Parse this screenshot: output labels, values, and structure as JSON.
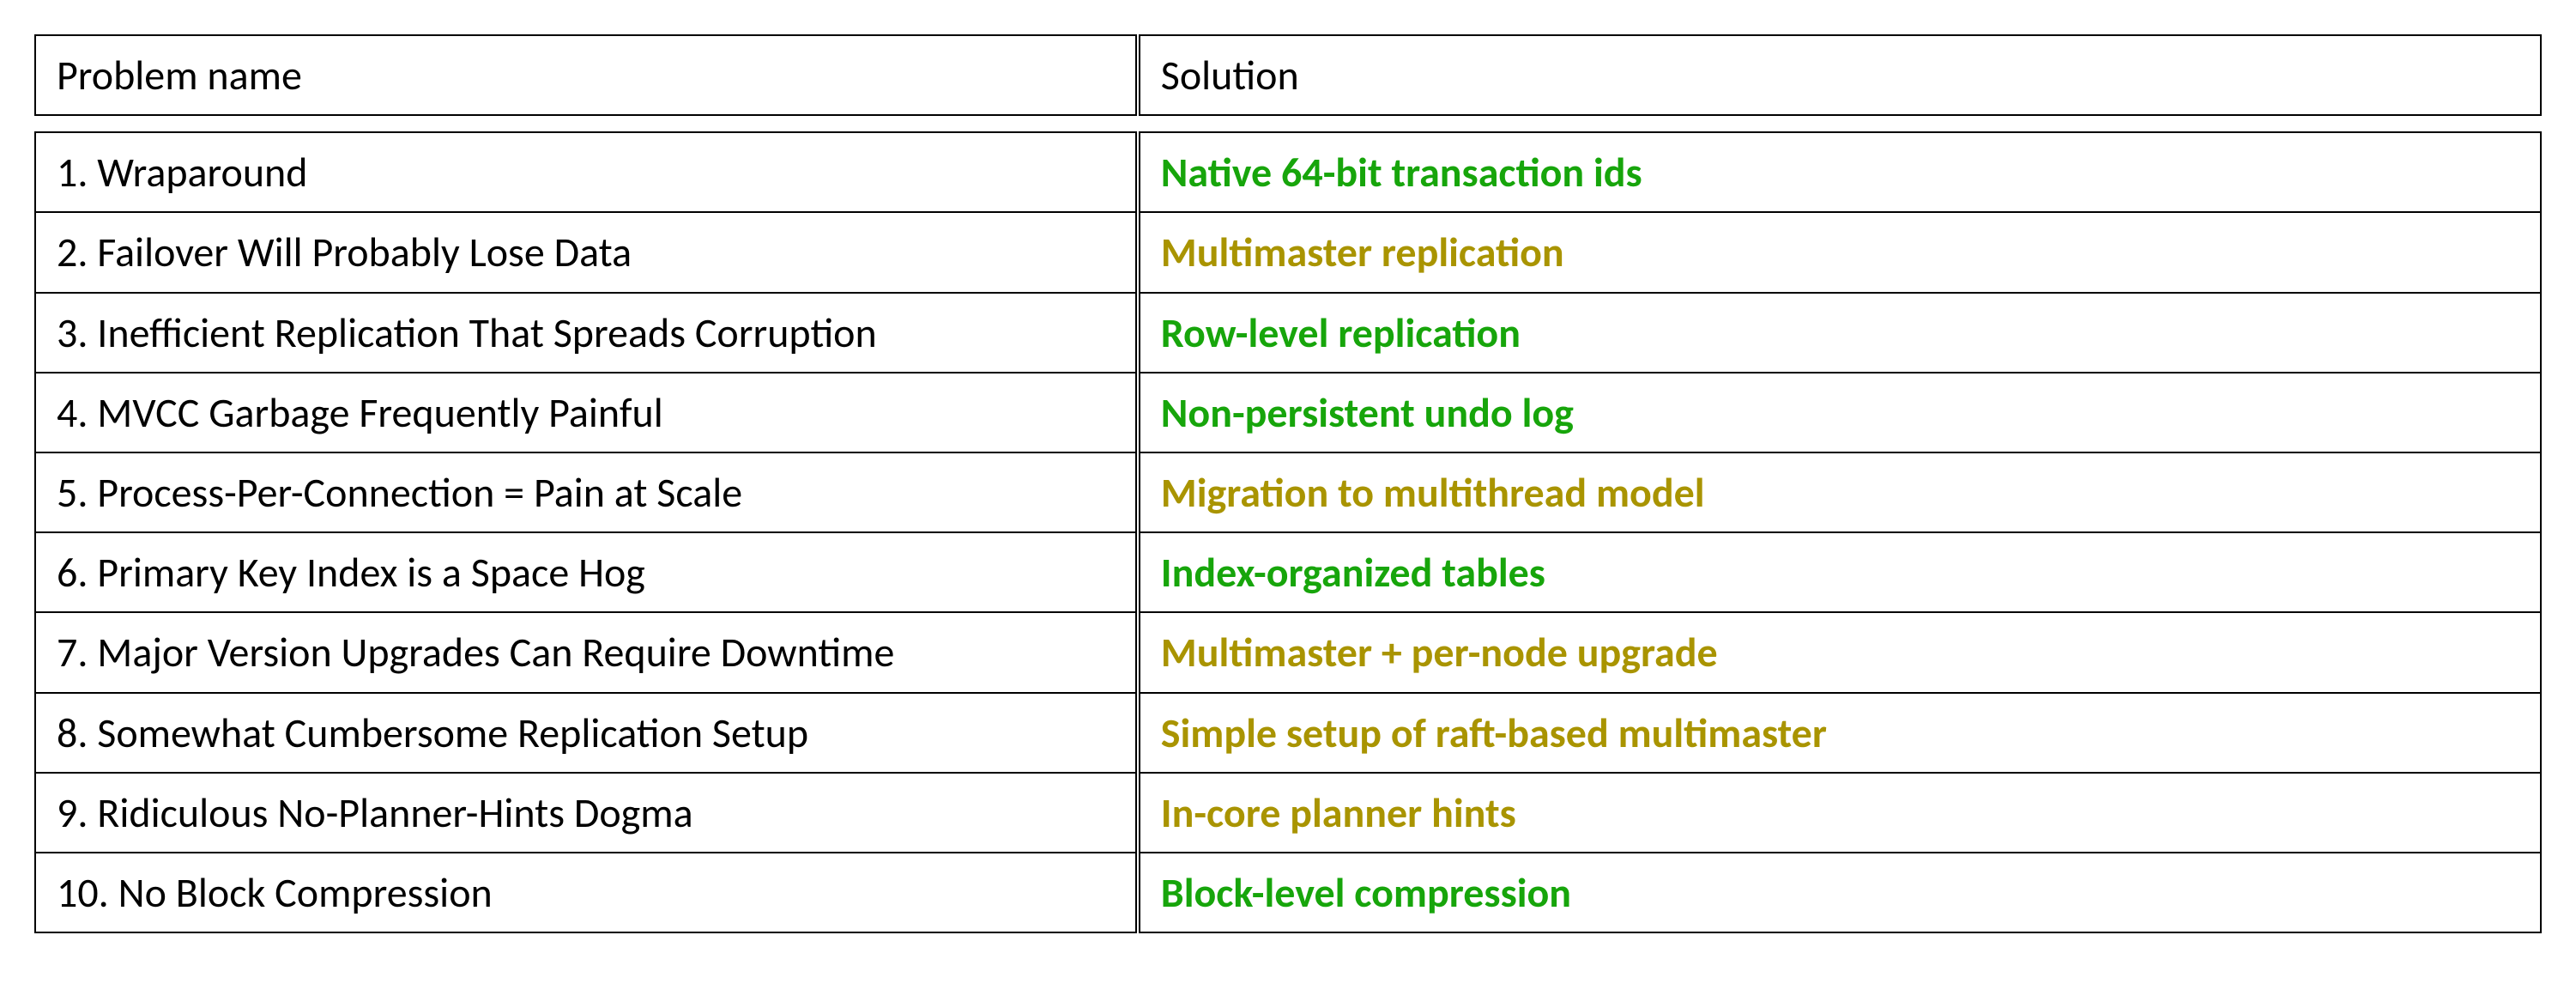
{
  "headers": {
    "problem": "Problem name",
    "solution": "Solution"
  },
  "rows": [
    {
      "problem": "1. Wraparound",
      "solution": "Native 64-bit transaction ids",
      "color": "green"
    },
    {
      "problem": "2. Failover Will Probably Lose Data",
      "solution": "Multimaster replication",
      "color": "olive"
    },
    {
      "problem": "3. Inefficient Replication That Spreads Corruption",
      "solution": "Row-level replication",
      "color": "green"
    },
    {
      "problem": "4. MVCC Garbage Frequently Painful",
      "solution": "Non-persistent undo log",
      "color": "green"
    },
    {
      "problem": "5. Process-Per-Connection = Pain at Scale",
      "solution": "Migration to multithread model",
      "color": "olive"
    },
    {
      "problem": "6. Primary Key Index is a Space Hog",
      "solution": "Index-organized tables",
      "color": "green"
    },
    {
      "problem": "7. Major Version Upgrades Can Require Downtime",
      "solution": "Multimaster + per-node upgrade",
      "color": "olive"
    },
    {
      "problem": "8. Somewhat Cumbersome Replication Setup",
      "solution": "Simple setup of raft-based multimaster",
      "color": "olive"
    },
    {
      "problem": "9. Ridiculous No-Planner-Hints Dogma",
      "solution": "In-core planner hints",
      "color": "olive"
    },
    {
      "problem": "10. No Block Compression",
      "solution": "Block-level compression",
      "color": "green"
    }
  ]
}
